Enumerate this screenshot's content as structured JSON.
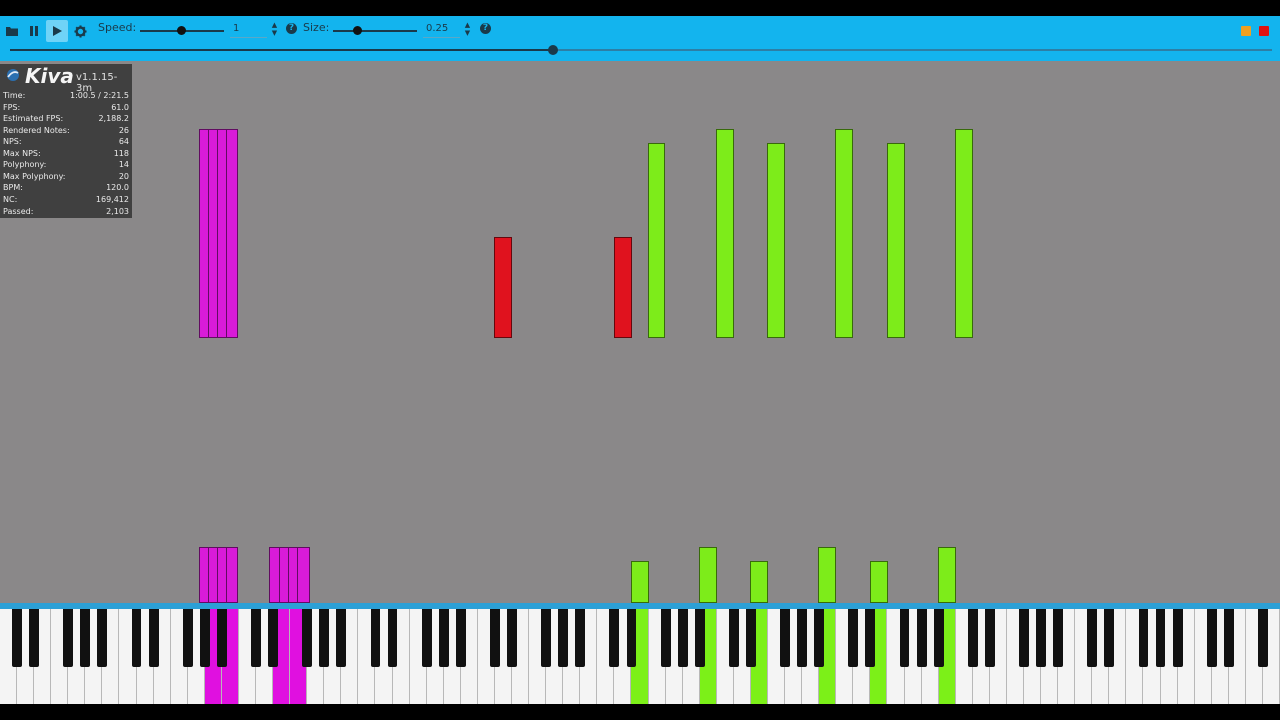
{
  "toolbar": {
    "speed_label": "Speed:",
    "speed_value": "1",
    "size_label": "Size:",
    "size_value": "0.25",
    "help_glyph": "?",
    "speed_slider_level": 0.5,
    "size_slider_level": 0.28,
    "seek_progress": 0.432,
    "icons": [
      "open-file-icon",
      "pause-icon",
      "play-icon",
      "gear-icon"
    ],
    "window_button_colors": [
      "#f0a020",
      "#e01010"
    ]
  },
  "stats": {
    "app_name": "Kiva",
    "version": "v1.1.15-3m",
    "rows": [
      {
        "label": "Time:",
        "value": "1:00.5 / 2:21.5"
      },
      {
        "label": "FPS:",
        "value": "61.0"
      },
      {
        "label": "Estimated FPS:",
        "value": "2,188.2"
      },
      {
        "label": "Rendered Notes:",
        "value": "26"
      },
      {
        "label": "NPS:",
        "value": "64"
      },
      {
        "label": "Max NPS:",
        "value": "118"
      },
      {
        "label": "Polyphony:",
        "value": "14"
      },
      {
        "label": "Max Polyphony:",
        "value": "20"
      },
      {
        "label": "BPM:",
        "value": "120.0"
      },
      {
        "label": "NC:",
        "value": "169,412"
      },
      {
        "label": "Passed:",
        "value": "2,103"
      }
    ]
  },
  "colors": {
    "toolbar": "#13b4ee",
    "stage": "#8a8889",
    "magenta_track": "#d81bd8",
    "green_track": "#7dec1a",
    "red_track": "#e0121e"
  },
  "keyboard": {
    "pressed_magenta_color": "#e010e0",
    "pressed_green_color": "#7cf018"
  }
}
